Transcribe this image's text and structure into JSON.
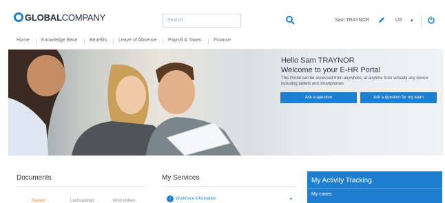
{
  "header": {
    "logo_bold": "GLOBAL",
    "logo_rest": "COMPANY",
    "search_placeholder": "Search",
    "user_name": "Sam TRAYNOR",
    "language": "US",
    "language_caret": "▾"
  },
  "nav": {
    "items": [
      "Home",
      "Knowledge Base",
      "Benefits",
      "Leave of Absence",
      "Payroll & Taxes",
      "Finance"
    ]
  },
  "hero": {
    "greeting": "Hello Sam TRAYNOR",
    "welcome": "Welcome to your E-HR Portal",
    "description": "This Portal can be accessed from anywhere, at anytime from virtually any device including tablets and smartphones",
    "button_ask": "Ask a question",
    "button_ask_team": "Ask a question for my team"
  },
  "documents": {
    "title": "Documents",
    "tabs": [
      "Recent",
      "Last updated",
      "Most visited"
    ]
  },
  "services": {
    "title": "My Services",
    "first_item": "Workforce information",
    "caret": "▾"
  },
  "activity": {
    "title": "My Activity Tracking",
    "first_item": "My cases"
  },
  "colors": {
    "accent": "#1e7fd0",
    "active_tab": "#e98a2b"
  },
  "icons": {
    "search": "search-icon",
    "edit": "pencil-icon",
    "logout": "power-icon"
  }
}
